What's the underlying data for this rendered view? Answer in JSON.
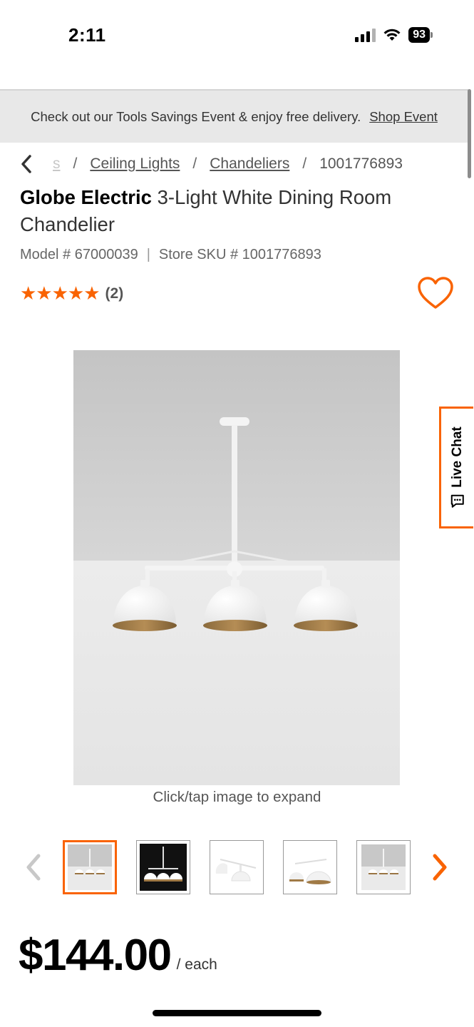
{
  "status_bar": {
    "time": "2:11",
    "battery": "93"
  },
  "promo": {
    "text": "Check out our Tools Savings Event & enjoy free delivery.",
    "link": "Shop Event"
  },
  "breadcrumb": {
    "faded": "s",
    "items": [
      "Ceiling Lights",
      "Chandeliers"
    ],
    "current": "1001776893",
    "separator": "/"
  },
  "product": {
    "brand": "Globe Electric",
    "name": "3-Light White Dining Room Chandelier",
    "model": "Model # 67000039",
    "sku": "Store SKU # 1001776893",
    "model_sep": "|",
    "stars": "★★★★★",
    "rating_value": 5,
    "review_count": "(2)",
    "image_caption": "Click/tap image to expand",
    "price": "$144.00",
    "price_unit": "/ each"
  },
  "live_chat": {
    "label": "Live Chat"
  },
  "colors": {
    "accent": "#f96302",
    "promo_bg": "#e8e8e8"
  },
  "icons": {
    "back": "chevron-left-icon",
    "favorite": "heart-icon",
    "chat": "chat-bubble-icon",
    "thumb_prev": "chevron-left-icon",
    "thumb_next": "chevron-right-icon"
  }
}
